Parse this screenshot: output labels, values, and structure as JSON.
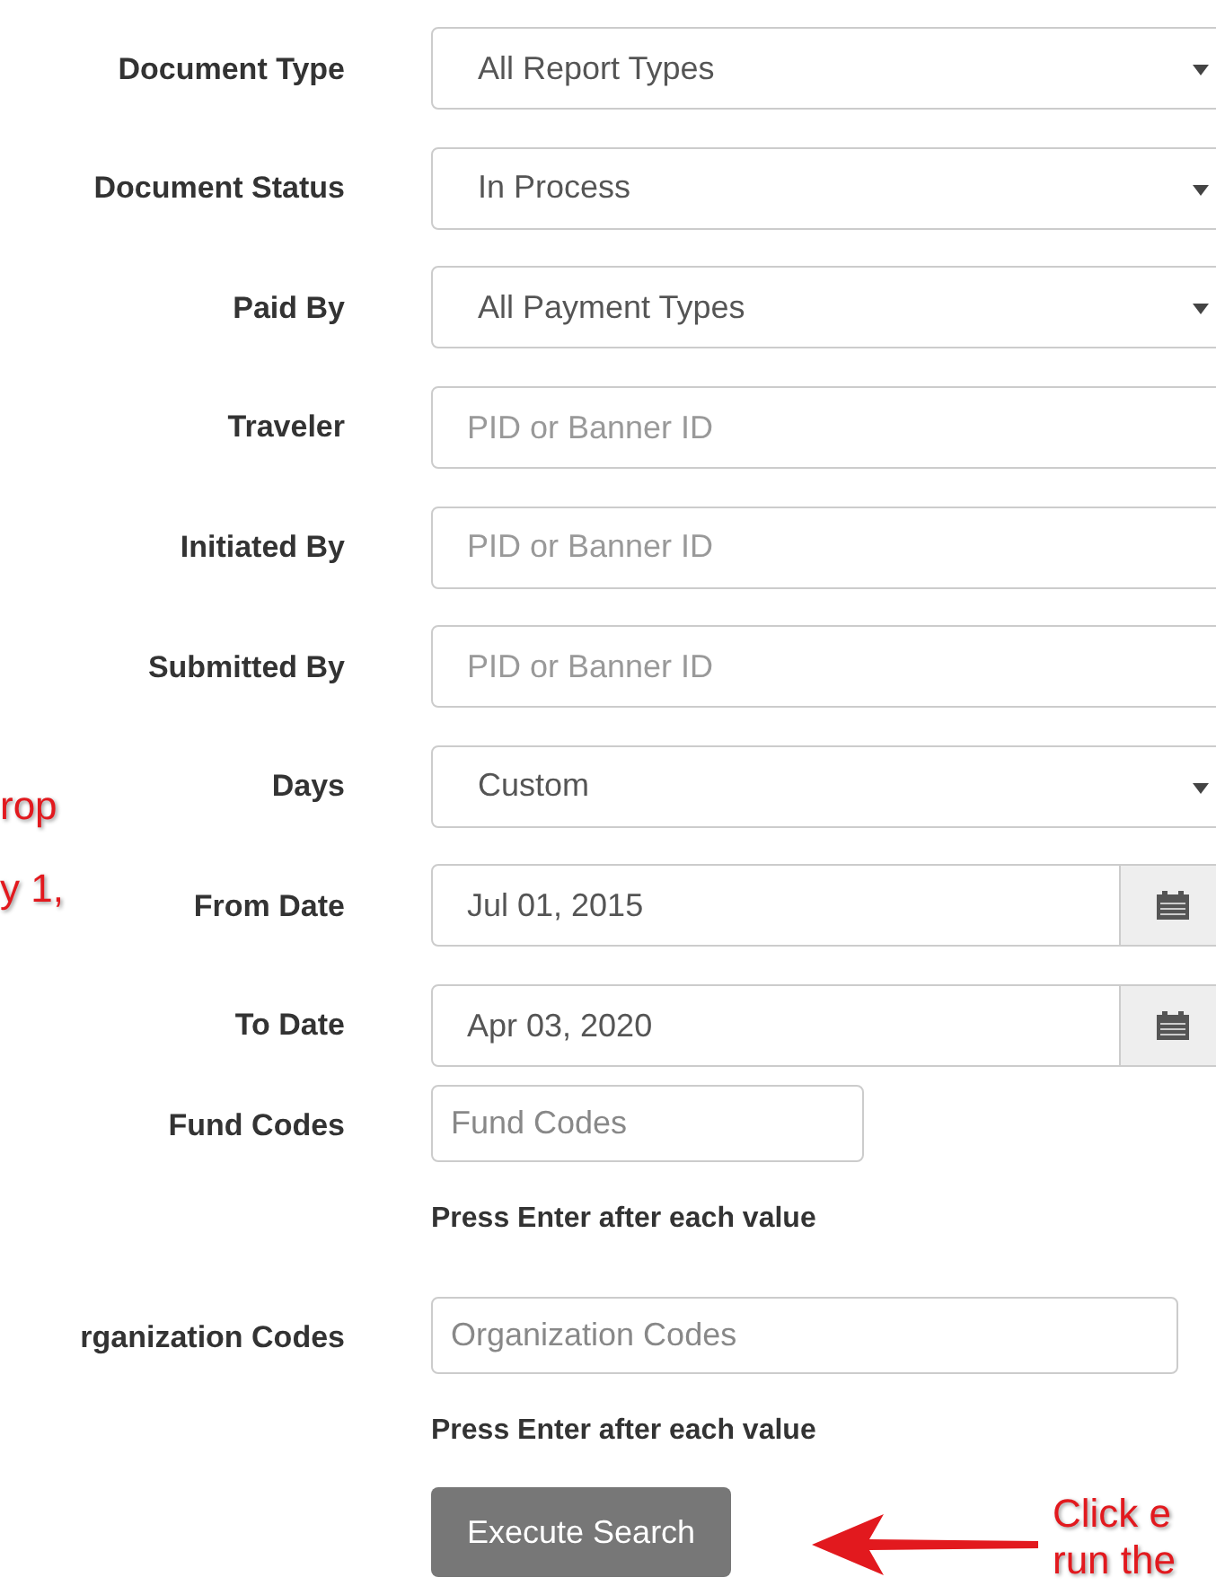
{
  "fields": [
    {
      "kind": "select",
      "label": "Document Type",
      "value": "All Report Types"
    },
    {
      "kind": "select",
      "label": "Document Status",
      "value": "In Process"
    },
    {
      "kind": "select",
      "label": "Paid By",
      "value": "All Payment Types"
    },
    {
      "kind": "input",
      "label": "Traveler",
      "placeholder": "PID or Banner ID"
    },
    {
      "kind": "input",
      "label": "Initiated By",
      "placeholder": "PID or Banner ID"
    },
    {
      "kind": "input",
      "label": "Submitted By",
      "placeholder": "PID or Banner ID"
    },
    {
      "kind": "select",
      "label": "Days",
      "value": "Custom"
    },
    {
      "kind": "date",
      "label": "From Date",
      "value": "Jul 01, 2015"
    },
    {
      "kind": "date",
      "label": "To Date",
      "value": "Apr 03, 2020"
    },
    {
      "kind": "codes",
      "label": "Fund Codes",
      "placeholder": "Fund Codes",
      "help": "Press Enter after each value"
    },
    {
      "kind": "codes_wide",
      "label": "rganization Codes",
      "placeholder": "Organization Codes",
      "help": "Press Enter after each value"
    }
  ],
  "search_button": "Execute Search",
  "annotations": [
    {
      "kind": "left",
      "text": "rop"
    },
    {
      "kind": "left",
      "text": "y 1,"
    },
    {
      "kind": "right",
      "text": "Click e"
    },
    {
      "kind": "right",
      "text": "run the"
    }
  ]
}
